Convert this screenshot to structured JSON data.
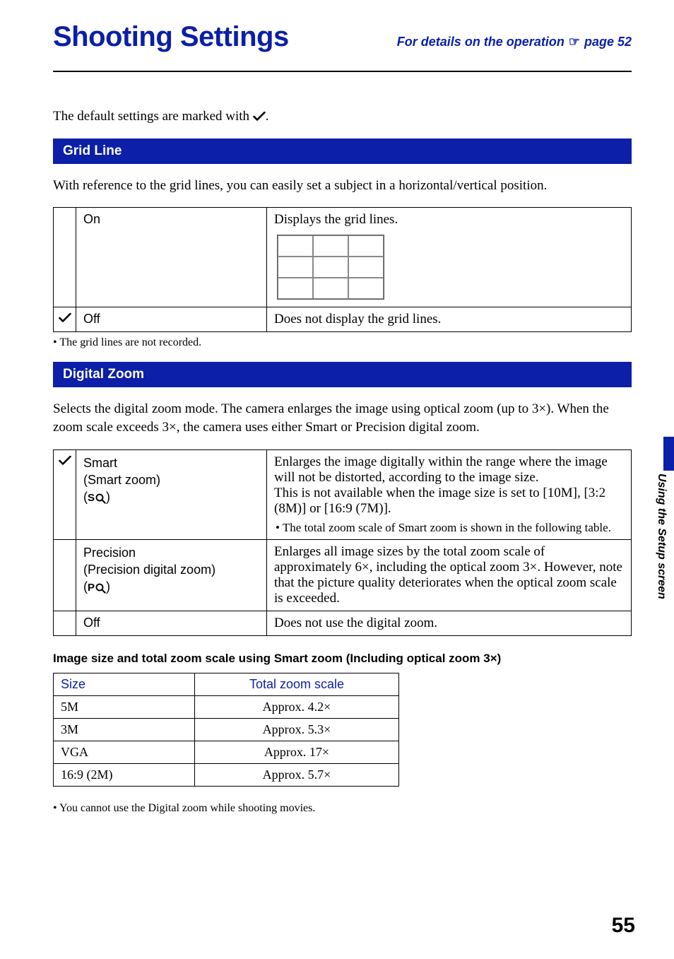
{
  "header": {
    "title": "Shooting Settings",
    "subtitle_prefix": "For details on the operation",
    "subtitle_page_ref": "page 52"
  },
  "intro": {
    "text_before": "The default settings are marked with ",
    "text_after": "."
  },
  "sections": {
    "grid_line": {
      "heading": "Grid Line",
      "desc": "With reference to the grid lines, you can easily set a subject in a horizontal/vertical position.",
      "options": [
        {
          "default": false,
          "name": "On",
          "desc": "Displays the grid lines."
        },
        {
          "default": true,
          "name": "Off",
          "desc": "Does not display the grid lines."
        }
      ],
      "note": "The grid lines are not recorded."
    },
    "digital_zoom": {
      "heading": "Digital Zoom",
      "desc": "Selects the digital zoom mode. The camera enlarges the image using optical zoom (up to 3×). When the zoom scale exceeds 3×, the camera uses either Smart or Precision digital zoom.",
      "options": [
        {
          "default": true,
          "name_line1": "Smart",
          "name_line2": "(Smart zoom)",
          "icon_prefix": "S",
          "desc": "Enlarges the image digitally within the range where the image will not be distorted, according to the image size.\nThis is not available when the image size is set to [10M], [3:2 (8M)] or [16:9 (7M)].",
          "subnote": "The total zoom scale of Smart zoom is shown in the following table."
        },
        {
          "default": false,
          "name_line1": "Precision",
          "name_line2": "(Precision digital zoom)",
          "icon_prefix": "P",
          "desc": "Enlarges all image sizes by the total zoom scale of approximately 6×, including the optical zoom 3×. However, note that the picture quality deteriorates when the optical zoom scale is exceeded."
        },
        {
          "default": false,
          "name_line1": "Off",
          "desc": "Does not use the digital zoom."
        }
      ],
      "zoom_table": {
        "heading": "Image size and total zoom scale using Smart zoom (Including optical zoom 3×)",
        "col1": "Size",
        "col2": "Total zoom scale",
        "rows": [
          {
            "size": "5M",
            "scale": "Approx. 4.2×"
          },
          {
            "size": "3M",
            "scale": "Approx. 5.3×"
          },
          {
            "size": "VGA",
            "scale": "Approx. 17×"
          },
          {
            "size": "16:9 (2M)",
            "scale": "Approx. 5.7×"
          }
        ]
      },
      "note": "You cannot use the Digital zoom while shooting movies."
    }
  },
  "side_tab": "Using the Setup screen",
  "page_number": "55"
}
